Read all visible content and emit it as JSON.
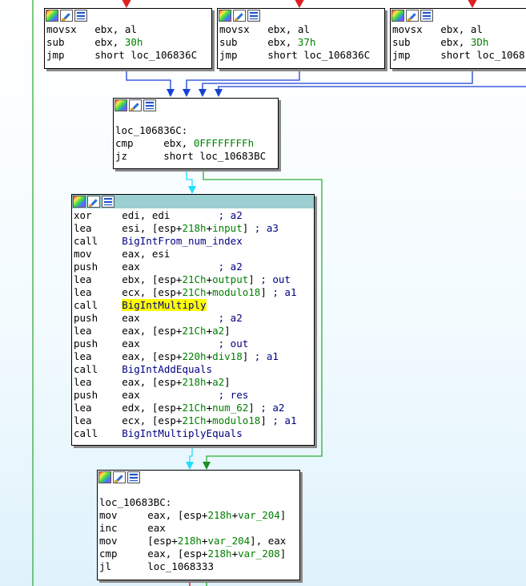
{
  "nodes": [
    {
      "id": "top1",
      "lines": [
        {
          "mn": "movsx",
          "ops": [
            {
              "t": "ebx, al",
              "c": "op"
            }
          ]
        },
        {
          "mn": "sub",
          "ops": [
            {
              "t": "ebx, ",
              "c": "op"
            },
            {
              "t": "30h",
              "c": "num"
            }
          ]
        },
        {
          "mn": "jmp",
          "ops": [
            {
              "t": "short loc_106836C",
              "c": "op"
            }
          ]
        }
      ]
    },
    {
      "id": "top2",
      "lines": [
        {
          "mn": "movsx",
          "ops": [
            {
              "t": "ebx, al",
              "c": "op"
            }
          ]
        },
        {
          "mn": "sub",
          "ops": [
            {
              "t": "ebx, ",
              "c": "op"
            },
            {
              "t": "37h",
              "c": "num"
            }
          ]
        },
        {
          "mn": "jmp",
          "ops": [
            {
              "t": "short loc_106836C",
              "c": "op"
            }
          ]
        }
      ]
    },
    {
      "id": "top3",
      "lines": [
        {
          "mn": "movsx",
          "ops": [
            {
              "t": "ebx, al",
              "c": "op"
            }
          ]
        },
        {
          "mn": "sub",
          "ops": [
            {
              "t": "ebx, ",
              "c": "op"
            },
            {
              "t": "3Dh",
              "c": "num"
            }
          ]
        },
        {
          "mn": "jmp",
          "ops": [
            {
              "t": "short loc_1068",
              "c": "op"
            }
          ]
        }
      ]
    },
    {
      "id": "mid",
      "label": "loc_106836C:",
      "lines": [
        {
          "mn": "cmp",
          "ops": [
            {
              "t": "ebx, ",
              "c": "op"
            },
            {
              "t": "0FFFFFFFFh",
              "c": "num"
            }
          ]
        },
        {
          "mn": "jz",
          "ops": [
            {
              "t": "short loc_10683BC",
              "c": "op"
            }
          ]
        }
      ]
    },
    {
      "id": "big",
      "lines": [
        {
          "mn": "xor",
          "ops": [
            {
              "t": "edi, edi",
              "c": "op"
            },
            {
              "t": "        ; a2",
              "c": "cm"
            }
          ]
        },
        {
          "mn": "lea",
          "ops": [
            {
              "t": "esi, [esp+",
              "c": "op"
            },
            {
              "t": "218h",
              "c": "num"
            },
            {
              "t": "+",
              "c": "op"
            },
            {
              "t": "input",
              "c": "var"
            },
            {
              "t": "]",
              "c": "op"
            },
            {
              "t": " ; a3",
              "c": "cm"
            }
          ]
        },
        {
          "mn": "call",
          "ops": [
            {
              "t": "BigIntFrom_num_index",
              "c": "fn"
            }
          ]
        },
        {
          "mn": "mov",
          "ops": [
            {
              "t": "eax, esi",
              "c": "op"
            }
          ]
        },
        {
          "mn": "push",
          "ops": [
            {
              "t": "eax",
              "c": "op"
            },
            {
              "t": "             ; a2",
              "c": "cm"
            }
          ]
        },
        {
          "mn": "lea",
          "ops": [
            {
              "t": "ebx, [esp+",
              "c": "op"
            },
            {
              "t": "21Ch",
              "c": "num"
            },
            {
              "t": "+",
              "c": "op"
            },
            {
              "t": "output",
              "c": "var"
            },
            {
              "t": "]",
              "c": "op"
            },
            {
              "t": " ; out",
              "c": "cm"
            }
          ]
        },
        {
          "mn": "lea",
          "ops": [
            {
              "t": "ecx, [esp+",
              "c": "op"
            },
            {
              "t": "21Ch",
              "c": "num"
            },
            {
              "t": "+",
              "c": "op"
            },
            {
              "t": "modulo18",
              "c": "var"
            },
            {
              "t": "]",
              "c": "op"
            },
            {
              "t": " ; a1",
              "c": "cm"
            }
          ]
        },
        {
          "mn": "call",
          "ops": [
            {
              "t": "BigIntMultiply",
              "c": "hl"
            }
          ]
        },
        {
          "mn": "push",
          "ops": [
            {
              "t": "eax",
              "c": "op"
            },
            {
              "t": "             ; a2",
              "c": "cm"
            }
          ]
        },
        {
          "mn": "lea",
          "ops": [
            {
              "t": "eax, [esp+",
              "c": "op"
            },
            {
              "t": "21Ch",
              "c": "num"
            },
            {
              "t": "+",
              "c": "op"
            },
            {
              "t": "a2",
              "c": "var"
            },
            {
              "t": "]",
              "c": "op"
            }
          ]
        },
        {
          "mn": "push",
          "ops": [
            {
              "t": "eax",
              "c": "op"
            },
            {
              "t": "             ; out",
              "c": "cm"
            }
          ]
        },
        {
          "mn": "lea",
          "ops": [
            {
              "t": "eax, [esp+",
              "c": "op"
            },
            {
              "t": "220h",
              "c": "num"
            },
            {
              "t": "+",
              "c": "op"
            },
            {
              "t": "div18",
              "c": "var"
            },
            {
              "t": "]",
              "c": "op"
            },
            {
              "t": " ; a1",
              "c": "cm"
            }
          ]
        },
        {
          "mn": "call",
          "ops": [
            {
              "t": "BigIntAddEquals",
              "c": "fn"
            }
          ]
        },
        {
          "mn": "lea",
          "ops": [
            {
              "t": "eax, [esp+",
              "c": "op"
            },
            {
              "t": "218h",
              "c": "num"
            },
            {
              "t": "+",
              "c": "op"
            },
            {
              "t": "a2",
              "c": "var"
            },
            {
              "t": "]",
              "c": "op"
            }
          ]
        },
        {
          "mn": "push",
          "ops": [
            {
              "t": "eax",
              "c": "op"
            },
            {
              "t": "             ; res",
              "c": "cm"
            }
          ]
        },
        {
          "mn": "lea",
          "ops": [
            {
              "t": "edx, [esp+",
              "c": "op"
            },
            {
              "t": "21Ch",
              "c": "num"
            },
            {
              "t": "+",
              "c": "op"
            },
            {
              "t": "num_62",
              "c": "var"
            },
            {
              "t": "]",
              "c": "op"
            },
            {
              "t": " ; a2",
              "c": "cm"
            }
          ]
        },
        {
          "mn": "lea",
          "ops": [
            {
              "t": "ecx, [esp+",
              "c": "op"
            },
            {
              "t": "21Ch",
              "c": "num"
            },
            {
              "t": "+",
              "c": "op"
            },
            {
              "t": "modulo18",
              "c": "var"
            },
            {
              "t": "]",
              "c": "op"
            },
            {
              "t": " ; a1",
              "c": "cm"
            }
          ]
        },
        {
          "mn": "call",
          "ops": [
            {
              "t": "BigIntMultiplyEquals",
              "c": "fn"
            }
          ]
        }
      ]
    },
    {
      "id": "bot",
      "label": "loc_10683BC:",
      "lines": [
        {
          "mn": "mov",
          "ops": [
            {
              "t": "eax, [esp+",
              "c": "op"
            },
            {
              "t": "218h",
              "c": "num"
            },
            {
              "t": "+",
              "c": "op"
            },
            {
              "t": "var_204",
              "c": "var"
            },
            {
              "t": "]",
              "c": "op"
            }
          ]
        },
        {
          "mn": "inc",
          "ops": [
            {
              "t": "eax",
              "c": "op"
            }
          ]
        },
        {
          "mn": "mov",
          "ops": [
            {
              "t": "[esp+",
              "c": "op"
            },
            {
              "t": "218h",
              "c": "num"
            },
            {
              "t": "+",
              "c": "op"
            },
            {
              "t": "var_204",
              "c": "var"
            },
            {
              "t": "], eax",
              "c": "op"
            }
          ]
        },
        {
          "mn": "cmp",
          "ops": [
            {
              "t": "eax, [esp+",
              "c": "op"
            },
            {
              "t": "218h",
              "c": "num"
            },
            {
              "t": "+",
              "c": "op"
            },
            {
              "t": "var_208",
              "c": "var"
            },
            {
              "t": "]",
              "c": "op"
            }
          ]
        },
        {
          "mn": "jl",
          "ops": [
            {
              "t": "loc_1068333",
              "c": "op"
            }
          ]
        }
      ]
    }
  ],
  "colors": {
    "normal_edge": "#0000ff",
    "true_edge": "#008000",
    "false_edge": "#ff0000",
    "fall_edge": "#00c8ff",
    "selected_title": "#9bcfd2"
  }
}
